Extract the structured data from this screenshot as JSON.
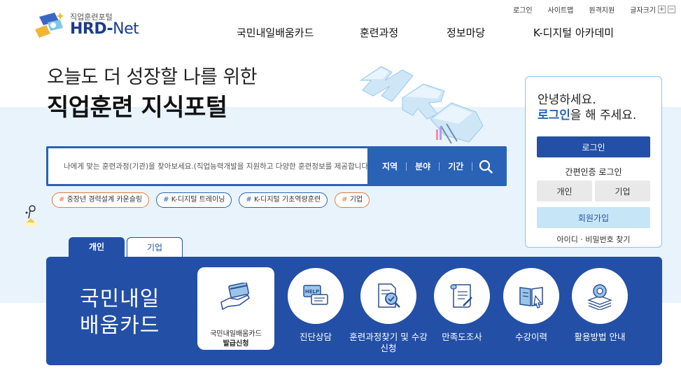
{
  "util": {
    "login": "로그인",
    "sitemap": "사이트맵",
    "remote": "원격지원",
    "fontsize": "글자크기",
    "plus": "+",
    "minus": "−"
  },
  "logo": {
    "sub": "직업훈련포털",
    "hrd": "HRD-",
    "net": "Net"
  },
  "nav": [
    "국민내일배움카드",
    "훈련과정",
    "정보마당",
    "K-디지털 아카데미"
  ],
  "hero": {
    "line1": "오늘도 더 성장할 나를 위한",
    "line2": "직업훈련 지식포털"
  },
  "search": {
    "placeholder": "나에게 맞는 훈련과정(기관)을 찾아보세요.(직업능력개발을 지원하고 다양한 훈련정보를 제공합니다.)",
    "filters": [
      "지역",
      "분야",
      "기간"
    ]
  },
  "tags": [
    {
      "hash": "#",
      "text": "중장년 경력설계 카운슬링",
      "color": "orange"
    },
    {
      "hash": "#",
      "text": "K-디지털 트레이닝",
      "color": "blue"
    },
    {
      "hash": "#",
      "text": "K-디지털 기초역량훈련",
      "color": "blue"
    },
    {
      "hash": "#",
      "text": "기업",
      "color": "orange"
    }
  ],
  "login": {
    "greet1": "안녕하세요.",
    "greet_hl": "로그인",
    "greet2": "을 해 주세요.",
    "login_button": "로그인",
    "easy_login": "간편인증 로그인",
    "personal": "개인",
    "company": "기업",
    "join": "회원가입",
    "find": "아이디 · 비밀번호 찾기"
  },
  "tabs": {
    "active": "개인",
    "inactive": "기업"
  },
  "panel": {
    "title_line1": "국민내일",
    "title_line2": "배움카드",
    "featured_line1": "국민내일배움카드",
    "featured_line2": "발급신청",
    "services": [
      {
        "label": "진단상담",
        "icon": "help-chat-icon"
      },
      {
        "label": "훈련과정찾기 및 수강신청",
        "icon": "document-search-icon"
      },
      {
        "label": "만족도조사",
        "icon": "survey-icon"
      },
      {
        "label": "수강이력",
        "icon": "book-icon"
      },
      {
        "label": "활용방법 안내",
        "icon": "gear-stack-icon"
      }
    ]
  },
  "colors": {
    "primary": "#234fa6",
    "search": "#2a62b5",
    "hero_bg": "#e8f3fb",
    "accent_orange": "#e07a3d",
    "join_bg": "#c6e6f7"
  }
}
